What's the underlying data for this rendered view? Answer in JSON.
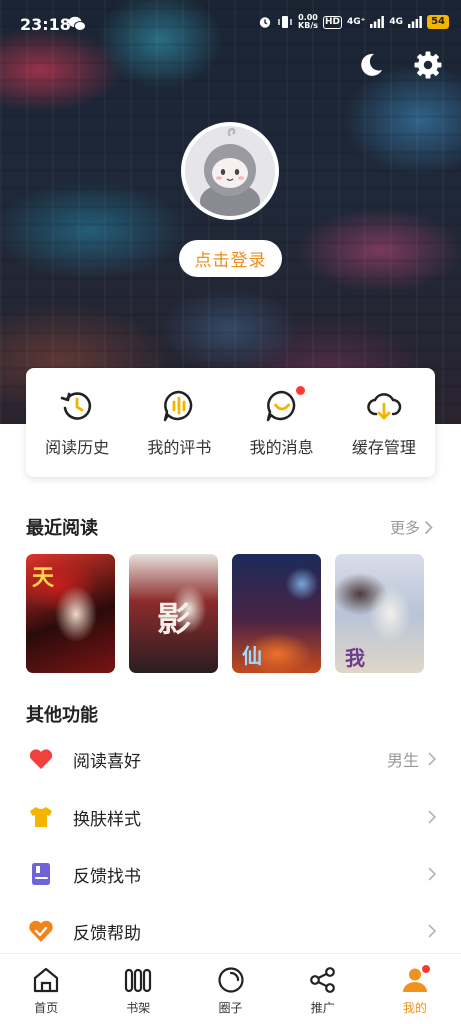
{
  "status_bar": {
    "time": "23:18",
    "net_speed": "0.00",
    "net_unit": "KB/s",
    "hd": "HD",
    "sig1": "4G⁺",
    "sig2": "4G",
    "battery": "54"
  },
  "header": {
    "login_label": "点击登录"
  },
  "quick_actions": [
    {
      "label": "阅读历史",
      "icon": "clock-history-icon"
    },
    {
      "label": "我的评书",
      "icon": "audio-review-icon"
    },
    {
      "label": "我的消息",
      "icon": "message-icon",
      "badge": true
    },
    {
      "label": "缓存管理",
      "icon": "cloud-download-icon"
    }
  ],
  "recent": {
    "title": "最近阅读",
    "more_label": "更多",
    "covers": [
      {
        "text": "天"
      },
      {
        "text": "影"
      },
      {
        "text": "仙"
      },
      {
        "text": "我"
      }
    ]
  },
  "other": {
    "title": "其他功能",
    "items": [
      {
        "label": "阅读喜好",
        "value": "男生",
        "icon": "heart-icon",
        "color": "#f0413e"
      },
      {
        "label": "换肤样式",
        "value": "",
        "icon": "tshirt-icon",
        "color": "#f5b400"
      },
      {
        "label": "反馈找书",
        "value": "",
        "icon": "book-icon",
        "color": "#6e63d9"
      },
      {
        "label": "反馈帮助",
        "value": "",
        "icon": "help-heart-icon",
        "color": "#f0841c"
      }
    ]
  },
  "bottom_nav": [
    {
      "label": "首页",
      "icon": "home-icon",
      "active": false
    },
    {
      "label": "书架",
      "icon": "bookshelf-icon",
      "active": false
    },
    {
      "label": "圈子",
      "icon": "circle-icon",
      "active": false
    },
    {
      "label": "推广",
      "icon": "share-icon",
      "active": false
    },
    {
      "label": "我的",
      "icon": "profile-icon",
      "active": true
    }
  ],
  "colors": {
    "accent": "#f0921c",
    "badge": "#ff3b30"
  }
}
